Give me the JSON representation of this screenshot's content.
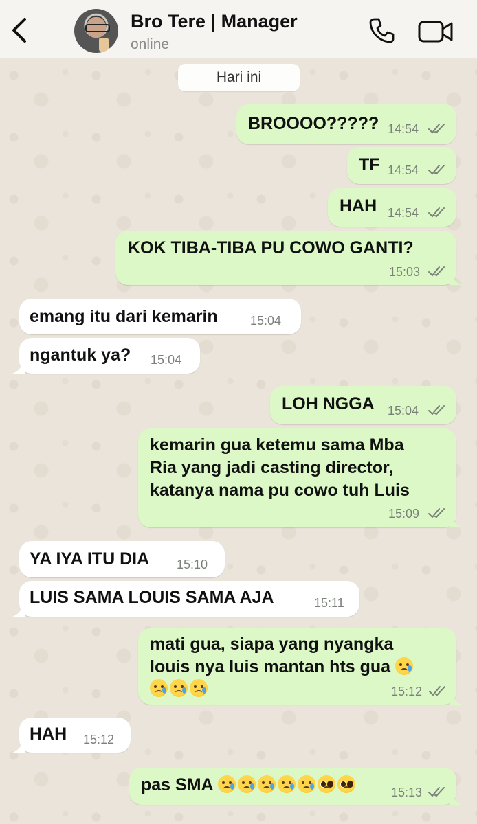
{
  "header": {
    "contact_name": "Bro Tere | Manager",
    "status": "online"
  },
  "chat": {
    "date_label": "Hari ini",
    "messages": [
      {
        "dir": "out",
        "text": "BROOOO?????",
        "time": "14:54"
      },
      {
        "dir": "out",
        "text": "TF",
        "time": "14:54"
      },
      {
        "dir": "out",
        "text": "HAH",
        "time": "14:54"
      },
      {
        "dir": "out",
        "text": "KOK TIBA-TIBA PU COWO GANTI?",
        "time": "15:03"
      },
      {
        "dir": "in",
        "text": "emang itu dari kemarin",
        "time": "15:04"
      },
      {
        "dir": "in",
        "text": "ngantuk ya?",
        "time": "15:04"
      },
      {
        "dir": "out",
        "text": "LOH NGGA",
        "time": "15:04"
      },
      {
        "dir": "out",
        "lines": [
          "kemarin gua ketemu sama Mba",
          "Ria yang jadi casting director,",
          "katanya nama pu cowo tuh Luis"
        ],
        "time": "15:09"
      },
      {
        "dir": "in",
        "text": "YA IYA ITU DIA",
        "time": "15:10"
      },
      {
        "dir": "in",
        "text": "LUIS SAMA LOUIS SAMA AJA",
        "time": "15:11"
      },
      {
        "dir": "out",
        "lines": [
          "mati gua, siapa yang nyangka",
          "louis nya luis mantan hts gua"
        ],
        "time": "15:12"
      },
      {
        "dir": "in",
        "text": "HAH",
        "time": "15:12"
      },
      {
        "dir": "out",
        "text": "pas SMA",
        "time": "15:13"
      }
    ]
  },
  "colors": {
    "outgoing_bubble": "#dcf8c6",
    "incoming_bubble": "#ffffff",
    "read_ticks": "#7b807a",
    "header_bg": "#f5f4f1",
    "wallpaper": "#ebe4da"
  },
  "icons": {
    "back": "chevron-left-icon",
    "call": "phone-icon",
    "video": "video-camera-icon",
    "read": "double-check-icon"
  }
}
